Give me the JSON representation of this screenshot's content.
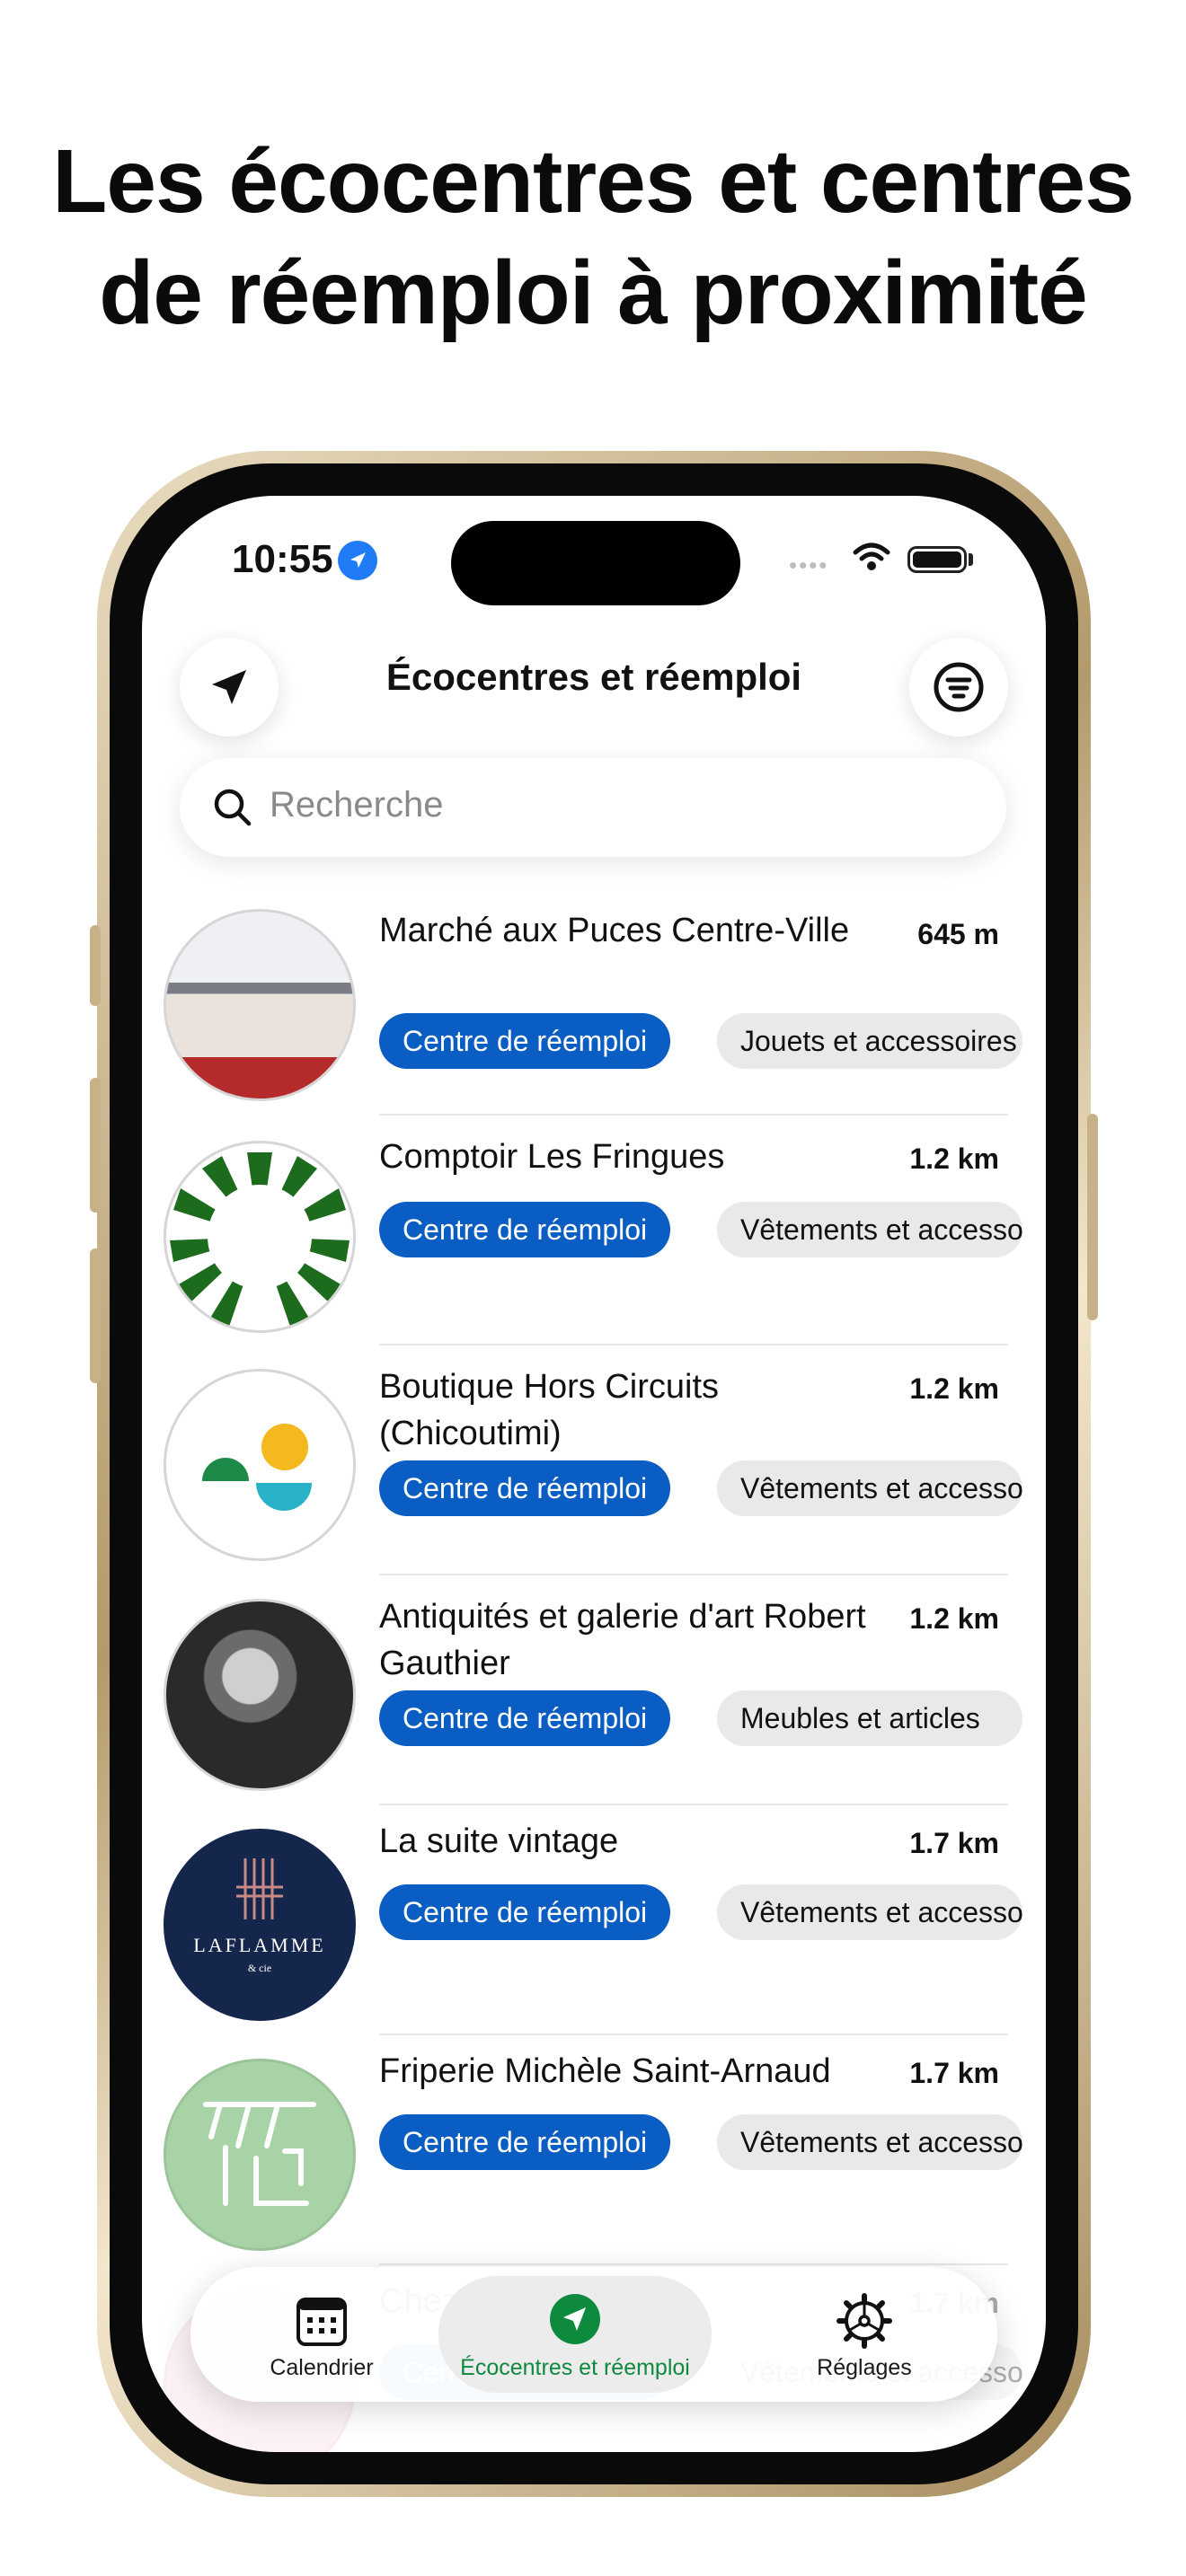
{
  "headline": {
    "line1": "Les écocentres et centres",
    "line2": "de réemploi à proximité"
  },
  "status_bar": {
    "time": "10:55"
  },
  "nav": {
    "title": "Écocentres et réemploi"
  },
  "search": {
    "placeholder": "Recherche"
  },
  "list": [
    {
      "name": "Marché aux Puces Centre-Ville",
      "distance": "645 m",
      "type": "Centre de réemploi",
      "category": "Jouets et accessoires"
    },
    {
      "name": "Comptoir Les Fringues",
      "distance": "1.2 km",
      "type": "Centre de réemploi",
      "category": "Vêtements et accessoires"
    },
    {
      "name": "Boutique Hors Circuits (Chicoutimi)",
      "distance": "1.2 km",
      "type": "Centre de réemploi",
      "category": "Vêtements et accessoires"
    },
    {
      "name": "Antiquités et galerie d'art Robert Gauthier",
      "distance": "1.2 km",
      "type": "Centre de réemploi",
      "category": "Meubles et articles"
    },
    {
      "name": "La suite vintage",
      "distance": "1.7 km",
      "type": "Centre de réemploi",
      "category": "Vêtements et accessoires",
      "logo_text": "LAFLAMME",
      "logo_subtext": "& cie"
    },
    {
      "name": "Friperie Michèle Saint-Arnaud",
      "distance": "1.7 km",
      "type": "Centre de réemploi",
      "category": "Vêtements et accessoires"
    },
    {
      "name": "Chez Marilyn",
      "distance": "1.7 km",
      "type": "Centre de réemploi",
      "category": "Vêtements et accessoires"
    }
  ],
  "tabbar": {
    "tabs": [
      {
        "label": "Calendrier",
        "icon": "calendar-icon"
      },
      {
        "label": "Écocentres et réemploi",
        "icon": "location-icon",
        "active": true
      },
      {
        "label": "Réglages",
        "icon": "gear-icon"
      }
    ]
  },
  "colors": {
    "accent_blue": "#0a5dc2",
    "active_green": "#0e8a3f",
    "location_blue": "#1f7cf6"
  }
}
